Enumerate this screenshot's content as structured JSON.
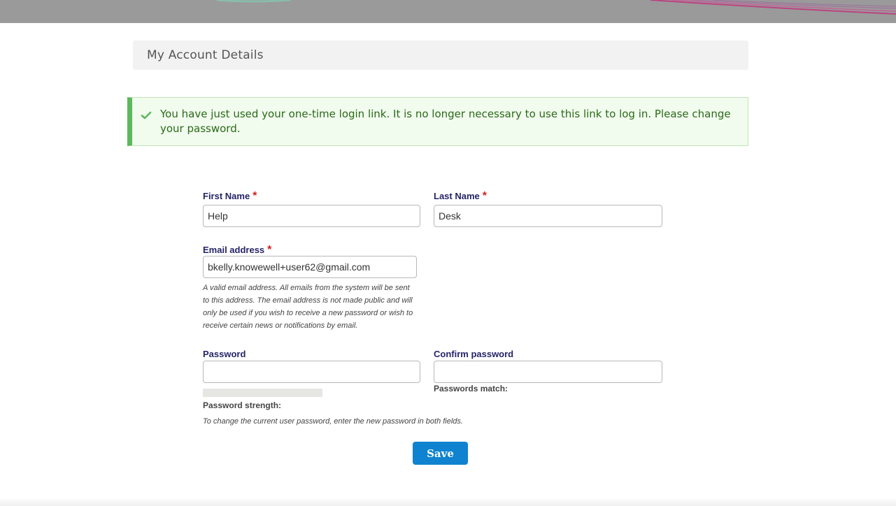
{
  "page": {
    "title": "My Account Details"
  },
  "status_message": {
    "text": "You have just used your one-time login link. It is no longer necessary to use this link to log in. Please change your password.",
    "icon": "check-icon",
    "accent_color": "#5cb85c"
  },
  "form": {
    "first_name": {
      "label": "First Name",
      "required_mark": "*",
      "value": "Help"
    },
    "last_name": {
      "label": "Last Name",
      "required_mark": "*",
      "value": "Desk"
    },
    "email": {
      "label": "Email address",
      "required_mark": "*",
      "value": "bkelly.knowewell+user62@gmail.com",
      "description": "A valid email address. All emails from the system will be sent to this address. The email address is not made public and will only be used if you wish to receive a new password or wish to receive certain news or notifications by email."
    },
    "password": {
      "label": "Password",
      "value": "",
      "strength_label": "Password strength:",
      "strength_level": 0
    },
    "confirm_password": {
      "label": "Confirm password",
      "value": "",
      "match_label": "Passwords match:"
    },
    "password_help": "To change the current user password, enter the new password in both fields.",
    "save_label": "Save"
  },
  "colors": {
    "label": "#252468",
    "required": "#d21f1f",
    "save_button": "#0f83cf"
  }
}
